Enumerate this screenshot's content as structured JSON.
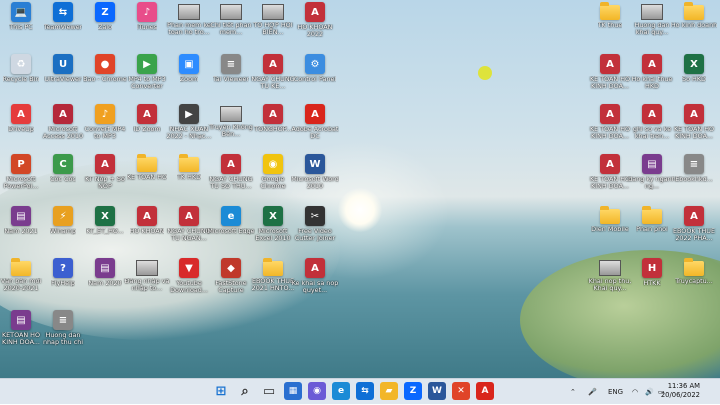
{
  "desktop_icons": [
    {
      "id": "this-pc",
      "label": "This PC",
      "color": "#2a7fd4",
      "glyph": "💻"
    },
    {
      "id": "teamviewer",
      "label": "TeamViewer",
      "color": "#0e6fd6",
      "glyph": "⇆"
    },
    {
      "id": "zalo",
      "label": "Zalo",
      "color": "#0a68ff",
      "glyph": "Z"
    },
    {
      "id": "itunes",
      "label": "iTunes",
      "color": "#e84d8a",
      "glyph": "♪"
    },
    {
      "id": "phan-mem-ke-toan",
      "label": "Phan mem ke toan ho tro...",
      "color": "#666",
      "glyph": ""
    },
    {
      "id": "chi-tiet-phan-mem",
      "label": "Chỉ tiết phan mem...",
      "color": "#666",
      "glyph": ""
    },
    {
      "id": "ho-sao-hoi",
      "label": "TỔ HỢP HỘI BIẾN...",
      "color": "#666",
      "glyph": ""
    },
    {
      "id": "ho-khoan-2022",
      "label": "HO KHOAN 2022",
      "color": "#c2303a",
      "glyph": "A"
    },
    {
      "id": "recycle-bin",
      "label": "Recycle Bin",
      "color": "#cfd8e2",
      "glyph": "♻"
    },
    {
      "id": "ultraviewer",
      "label": "UltraViewer",
      "color": "#1b6fc2",
      "glyph": "U"
    },
    {
      "id": "coc-coc",
      "label": "Bao - Chrome",
      "color": "#e04428",
      "glyph": "●"
    },
    {
      "id": "mp4-converter",
      "label": "MP4 to MP3 Converter",
      "color": "#3aa34b",
      "glyph": "▶"
    },
    {
      "id": "zoom",
      "label": "Zoom",
      "color": "#2d8cff",
      "glyph": "▣"
    },
    {
      "id": "tai-vieweer",
      "label": "Tai Vieweer",
      "color": "#888",
      "glyph": "≡"
    },
    {
      "id": "ngay-chung-tu",
      "label": "NGAY CHUNG TU KE...",
      "color": "#c2303a",
      "glyph": "A"
    },
    {
      "id": "control-panel",
      "label": "Control Panel",
      "color": "#3c8de0",
      "glyph": "⚙"
    },
    {
      "id": "driveup",
      "label": "DriveUp",
      "color": "#e53c3c",
      "glyph": "A"
    },
    {
      "id": "microsoft-access",
      "label": "Microsoft Access 2010",
      "color": "#b5283a",
      "glyph": "A"
    },
    {
      "id": "convert-mp4",
      "label": "Convert MP4 to MP3",
      "color": "#f0a020",
      "glyph": "♪"
    },
    {
      "id": "id-zoom",
      "label": "ID Zoom",
      "color": "#c2303a",
      "glyph": "A"
    },
    {
      "id": "nhac-xuan",
      "label": "NHẠC XUÂN 2022 - Nhạc...",
      "color": "#444",
      "glyph": "▶"
    },
    {
      "id": "truyen-khong",
      "label": "Truyện Không Bên...",
      "color": "#888",
      "glyph": ""
    },
    {
      "id": "tonghop",
      "label": "TONGHOP...",
      "color": "#c2303a",
      "glyph": "A"
    },
    {
      "id": "adobe-acrobat",
      "label": "Adobe Acrobat DC",
      "color": "#d9261c",
      "glyph": "A"
    },
    {
      "id": "microsoft-powerpoint",
      "label": "Microsoft PowerPoi...",
      "color": "#d24726",
      "glyph": "P"
    },
    {
      "id": "coc-coc-browser",
      "label": "Cốc Cốc",
      "color": "#3c9a4b",
      "glyph": "C"
    },
    {
      "id": "kt-nop",
      "label": "KT Nộp + Sổ NOP",
      "color": "#c2303a",
      "glyph": "A"
    },
    {
      "id": "ke-toan-ho",
      "label": "KE TOAN HO",
      "color": "#f2b628",
      "glyph": "F"
    },
    {
      "id": "tk-hkd",
      "label": "TK HKD",
      "color": "#f2b628",
      "glyph": "F"
    },
    {
      "id": "ngay-chung-tu-2",
      "label": "NGAY CHUNG TU SO THU...",
      "color": "#c2303a",
      "glyph": "A"
    },
    {
      "id": "google-chrome",
      "label": "Google Chrome",
      "color": "#f1c40f",
      "glyph": "◉"
    },
    {
      "id": "microsoft-word",
      "label": "Microsoft Word 2010",
      "color": "#2b579a",
      "glyph": "W"
    },
    {
      "id": "nam-2021",
      "label": "Nam 2021",
      "color": "#7a3c8e",
      "glyph": "▤"
    },
    {
      "id": "winamp",
      "label": "Winamp",
      "color": "#e8a020",
      "glyph": "⚡"
    },
    {
      "id": "kt-et-ho",
      "label": "KT_ET_HO...",
      "color": "#1e7145",
      "glyph": "X"
    },
    {
      "id": "ho-khoan",
      "label": "HO KHOAN",
      "color": "#c2303a",
      "glyph": "A"
    },
    {
      "id": "ngay-chung-tu-3",
      "label": "NGAY CHUNG TU NGAN...",
      "color": "#c2303a",
      "glyph": "A"
    },
    {
      "id": "microsoft-edge",
      "label": "Microsoft Edge",
      "color": "#1b8bd6",
      "glyph": "e"
    },
    {
      "id": "microsoft-excel",
      "label": "Microsoft Excel 2010",
      "color": "#1e7145",
      "glyph": "X"
    },
    {
      "id": "free-video-cutter",
      "label": "Free Video Cutter Joiner",
      "color": "#333",
      "glyph": "✂"
    },
    {
      "id": "van-ban-moi",
      "label": "Văn bản mới 2020-2021",
      "color": "#f2b628",
      "glyph": "F"
    },
    {
      "id": "flyhelp",
      "label": "FlyHelp",
      "color": "#3c5fd0",
      "glyph": "?"
    },
    {
      "id": "nam-2020",
      "label": "Nam 2020",
      "color": "#7a3c8e",
      "glyph": "▤"
    },
    {
      "id": "dang-nhap",
      "label": "Đăng nhập và nhập to...",
      "color": "#666",
      "glyph": ""
    },
    {
      "id": "youtube-downloader",
      "label": "Youtube Download...",
      "color": "#d82a2a",
      "glyph": "▼"
    },
    {
      "id": "faststone-capture",
      "label": "FastStone Capture",
      "color": "#c0392b",
      "glyph": "◆"
    },
    {
      "id": "ebook-thue",
      "label": "EBOOK THUE 2021 HNTO...",
      "color": "#f2b628",
      "glyph": "F"
    },
    {
      "id": "ke-khai-sa",
      "label": "Ke khai sa nop quyet...",
      "color": "#c2303a",
      "glyph": "A"
    },
    {
      "id": "ketoan-ho",
      "label": "KETOAN HO KINH DOA...",
      "color": "#7a3c8e",
      "glyph": "▤"
    },
    {
      "id": "huong-dan",
      "label": "Huong dan nhap thu chi",
      "color": "#888",
      "glyph": "≡"
    }
  ],
  "right_icons": [
    {
      "id": "tk-thue",
      "label": "TK thue",
      "color": "#f2b628",
      "glyph": "F"
    },
    {
      "id": "huong-dan-khai",
      "label": "Huong dan khai quy...",
      "color": "#666",
      "glyph": ""
    },
    {
      "id": "ho-kinh-doanh",
      "label": "Ho kinh doanh",
      "color": "#f2b628",
      "glyph": "F"
    },
    {
      "id": "ke-toan-ho-2",
      "label": "KE TOAN HO KINH DOA...",
      "color": "#c2303a",
      "glyph": "A"
    },
    {
      "id": "ho-khai-hkd",
      "label": "Ho khai thue HKD",
      "color": "#c2303a",
      "glyph": "A"
    },
    {
      "id": "so-hkd",
      "label": "So HKD",
      "color": "#1e7145",
      "glyph": "X"
    },
    {
      "id": "ke-toan-ho-3",
      "label": "KE TOAN HO KINH DOA...",
      "color": "#c2303a",
      "glyph": "A"
    },
    {
      "id": "ghi-so",
      "label": "ghi so va ke khai tren...",
      "color": "#c2303a",
      "glyph": "A"
    },
    {
      "id": "ke-toan-ho-4",
      "label": "KE TOAN HO KINH DOA...",
      "color": "#c2303a",
      "glyph": "A"
    },
    {
      "id": "ke-toan-ho-5",
      "label": "KE TOAN HO KINH DOA...",
      "color": "#c2303a",
      "glyph": "A"
    },
    {
      "id": "dang-ky",
      "label": "dang ky nganh ng...",
      "color": "#7a3c8e",
      "glyph": "▤"
    },
    {
      "id": "ebookhkd",
      "label": "Ebookhkd...",
      "color": "#888",
      "glyph": "≡"
    },
    {
      "id": "dien-mobile",
      "label": "Dien Mobile",
      "color": "#f2b628",
      "glyph": "F"
    },
    {
      "id": "phan-phoi",
      "label": "Phan phoi",
      "color": "#f2b628",
      "glyph": "F"
    },
    {
      "id": "ebook-thue-2",
      "label": "EBOOK THUE 2022 PHA...",
      "color": "#c2303a",
      "glyph": "A"
    },
    {
      "id": "khai-nop",
      "label": "Khai nop thu, Khai quy...",
      "color": "#666",
      "glyph": ""
    },
    {
      "id": "htkk",
      "label": "HTKK",
      "color": "#c2303a",
      "glyph": "H"
    },
    {
      "id": "truycaptu",
      "label": "Truycaptu...",
      "color": "#f2b628",
      "glyph": "F"
    }
  ],
  "taskbar": {
    "apps": [
      {
        "id": "start",
        "glyph": "⊞",
        "color": "#1a73d0"
      },
      {
        "id": "search",
        "glyph": "⌕",
        "color": "#333"
      },
      {
        "id": "task-view",
        "glyph": "▭",
        "color": "#333"
      },
      {
        "id": "widgets",
        "glyph": "▦",
        "color": "#2a6fd0"
      },
      {
        "id": "chat",
        "glyph": "◉",
        "color": "#6b5bd6"
      },
      {
        "id": "edge",
        "glyph": "e",
        "color": "#1b8bd6"
      },
      {
        "id": "teamviewer",
        "glyph": "⇆",
        "color": "#0e6fd6"
      },
      {
        "id": "explorer",
        "glyph": "▰",
        "color": "#f2b628"
      },
      {
        "id": "zalo",
        "glyph": "Z",
        "color": "#0a68ff"
      },
      {
        "id": "word",
        "glyph": "W",
        "color": "#2b579a"
      },
      {
        "id": "cursor-app",
        "glyph": "✕",
        "color": "#e04428"
      },
      {
        "id": "acrobat",
        "glyph": "A",
        "color": "#d9261c"
      }
    ],
    "tray_language": "ENG",
    "time": "11:36 AM",
    "date": "20/06/2022"
  }
}
